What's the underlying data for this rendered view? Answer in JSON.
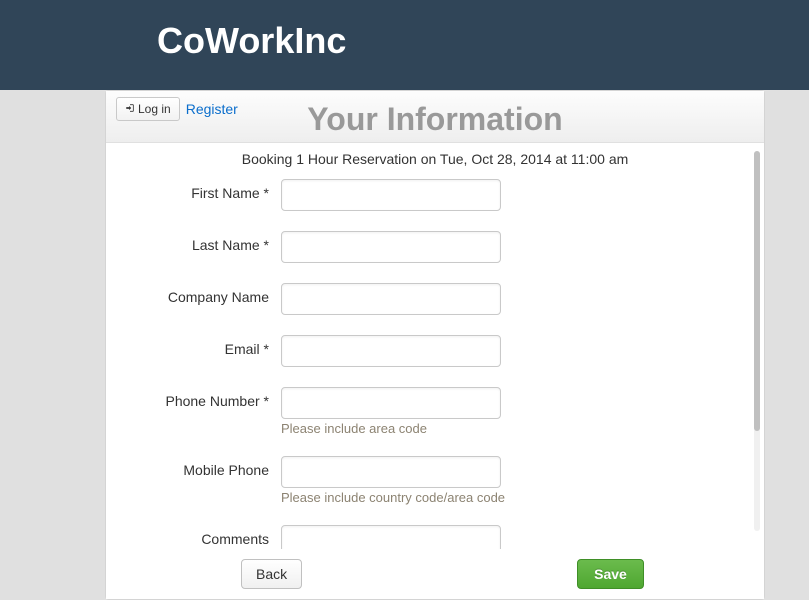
{
  "brand": "CoWorkInc",
  "auth": {
    "login_label": "Log in",
    "register_label": "Register"
  },
  "title": "Your Information",
  "booking_text": "Booking 1 Hour Reservation on Tue, Oct 28, 2014 at 11:00 am",
  "fields": {
    "first_name": {
      "label": "First Name *"
    },
    "last_name": {
      "label": "Last Name *"
    },
    "company_name": {
      "label": "Company Name"
    },
    "email": {
      "label": "Email *"
    },
    "phone": {
      "label": "Phone Number *",
      "help": "Please include area code"
    },
    "mobile": {
      "label": "Mobile Phone",
      "help": "Please include country code/area code"
    },
    "comments": {
      "label": "Comments"
    }
  },
  "buttons": {
    "back": "Back",
    "save": "Save"
  }
}
